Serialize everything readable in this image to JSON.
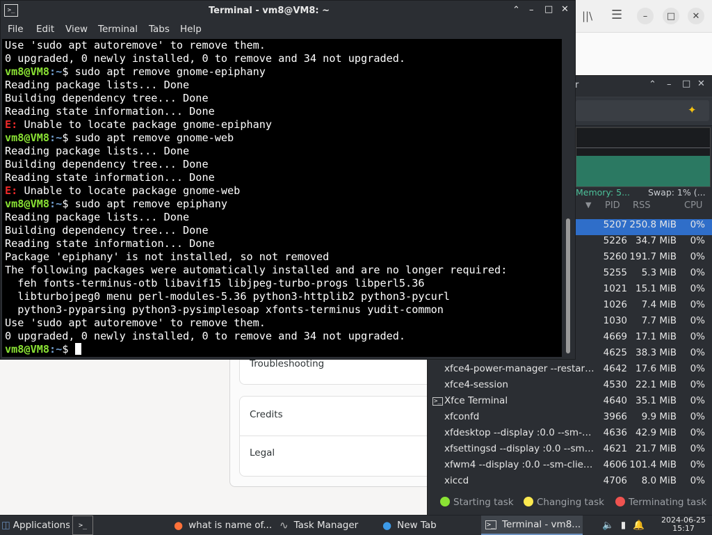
{
  "terminal": {
    "title": "Terminal - vm8@VM8: ~",
    "menu": [
      "File",
      "Edit",
      "View",
      "Terminal",
      "Tabs",
      "Help"
    ],
    "lines": [
      {
        "type": "text",
        "text": "Use 'sudo apt autoremove' to remove them."
      },
      {
        "type": "text",
        "text": "0 upgraded, 0 newly installed, 0 to remove and 34 not upgraded."
      },
      {
        "type": "prompt",
        "user": "vm8@VM8",
        "path": ":~",
        "cmd": "$ sudo apt remove gnome-epiphany"
      },
      {
        "type": "text",
        "text": "Reading package lists... Done"
      },
      {
        "type": "text",
        "text": "Building dependency tree... Done"
      },
      {
        "type": "text",
        "text": "Reading state information... Done"
      },
      {
        "type": "error",
        "label": "E:",
        "text": " Unable to locate package gnome-epiphany"
      },
      {
        "type": "prompt",
        "user": "vm8@VM8",
        "path": ":~",
        "cmd": "$ sudo apt remove gnome-web"
      },
      {
        "type": "text",
        "text": "Reading package lists... Done"
      },
      {
        "type": "text",
        "text": "Building dependency tree... Done"
      },
      {
        "type": "text",
        "text": "Reading state information... Done"
      },
      {
        "type": "error",
        "label": "E:",
        "text": " Unable to locate package gnome-web"
      },
      {
        "type": "prompt",
        "user": "vm8@VM8",
        "path": ":~",
        "cmd": "$ sudo apt remove epiphany"
      },
      {
        "type": "text",
        "text": "Reading package lists... Done"
      },
      {
        "type": "text",
        "text": "Building dependency tree... Done"
      },
      {
        "type": "text",
        "text": "Reading state information... Done"
      },
      {
        "type": "text",
        "text": "Package 'epiphany' is not installed, so not removed"
      },
      {
        "type": "text",
        "text": "The following packages were automatically installed and are no longer required:"
      },
      {
        "type": "text",
        "text": "  feh fonts-terminus-otb libavif15 libjpeg-turbo-progs libperl5.36"
      },
      {
        "type": "text",
        "text": "  libturbojpeg0 menu perl-modules-5.36 python3-httplib2 python3-pycurl"
      },
      {
        "type": "text",
        "text": "  python3-pyparsing python3-pysimplesoap xfonts-terminus yudit-common"
      },
      {
        "type": "text",
        "text": "Use 'sudo apt autoremove' to remove them."
      },
      {
        "type": "text",
        "text": "0 upgraded, 0 newly installed, 0 to remove and 34 not upgraded."
      },
      {
        "type": "prompt-cursor",
        "user": "vm8@VM8",
        "path": ":~",
        "cmd": "$ "
      }
    ]
  },
  "about": {
    "troubleshooting": "Troubleshooting",
    "credits": "Credits",
    "legal": "Legal"
  },
  "task_manager": {
    "title_fragment": "r",
    "memory": "Memory: 5...",
    "swap": "Swap: 1% (...",
    "columns": {
      "pid": "PID",
      "rss": "RSS",
      "cpu": "CPU"
    },
    "rows": [
      {
        "name": "",
        "pid": "5207",
        "rss": "250.8 MiB",
        "cpu": "0%",
        "selected": true
      },
      {
        "name": "",
        "pid": "5226",
        "rss": "34.7 MiB",
        "cpu": "0%"
      },
      {
        "name": "",
        "pid": "5260",
        "rss": "191.7 MiB",
        "cpu": "0%"
      },
      {
        "name": "",
        "pid": "5255",
        "rss": "5.3 MiB",
        "cpu": "0%"
      },
      {
        "name": "",
        "pid": "1021",
        "rss": "15.1 MiB",
        "cpu": "0%"
      },
      {
        "name": "",
        "pid": "1026",
        "rss": "7.4 MiB",
        "cpu": "0%"
      },
      {
        "name": "",
        "pid": "1030",
        "rss": "7.7 MiB",
        "cpu": "0%"
      },
      {
        "name": "",
        "pid": "4669",
        "rss": "17.1 MiB",
        "cpu": "0%"
      },
      {
        "name": "",
        "pid": "4625",
        "rss": "38.3 MiB",
        "cpu": "0%"
      },
      {
        "name": "xfce4-power-manager --restart ...",
        "pid": "4642",
        "rss": "17.6 MiB",
        "cpu": "0%"
      },
      {
        "name": "xfce4-session",
        "pid": "4530",
        "rss": "22.1 MiB",
        "cpu": "0%"
      },
      {
        "name": "Xfce Terminal",
        "pid": "4640",
        "rss": "35.1 MiB",
        "cpu": "0%",
        "icon": "terminal-icon"
      },
      {
        "name": "xfconfd",
        "pid": "3966",
        "rss": "9.9 MiB",
        "cpu": "0%"
      },
      {
        "name": "xfdesktop --display :0.0 --sm-cl...",
        "pid": "4636",
        "rss": "42.9 MiB",
        "cpu": "0%"
      },
      {
        "name": "xfsettingsd --display :0.0 --sm-...",
        "pid": "4621",
        "rss": "21.7 MiB",
        "cpu": "0%"
      },
      {
        "name": "xfwm4 --display :0.0 --sm-clien...",
        "pid": "4606",
        "rss": "101.4 MiB",
        "cpu": "0%"
      },
      {
        "name": "xiccd",
        "pid": "4706",
        "rss": "8.0 MiB",
        "cpu": "0%"
      }
    ],
    "legend": [
      {
        "label": "Starting task",
        "color": "#8ae234"
      },
      {
        "label": "Changing task",
        "color": "#fce94f"
      },
      {
        "label": "Terminating task",
        "color": "#ef5350"
      }
    ]
  },
  "taskbar": {
    "applications": "Applications",
    "items": [
      {
        "label": "what is name of...",
        "icon": "firefox-icon"
      },
      {
        "label": "Task Manager",
        "icon": "task-manager-icon"
      },
      {
        "label": "New Tab",
        "icon": "browser-icon"
      },
      {
        "label": "Terminal - vm8...",
        "icon": "terminal-icon",
        "active": true
      }
    ],
    "date": "2024-06-25",
    "time": "15:17"
  }
}
